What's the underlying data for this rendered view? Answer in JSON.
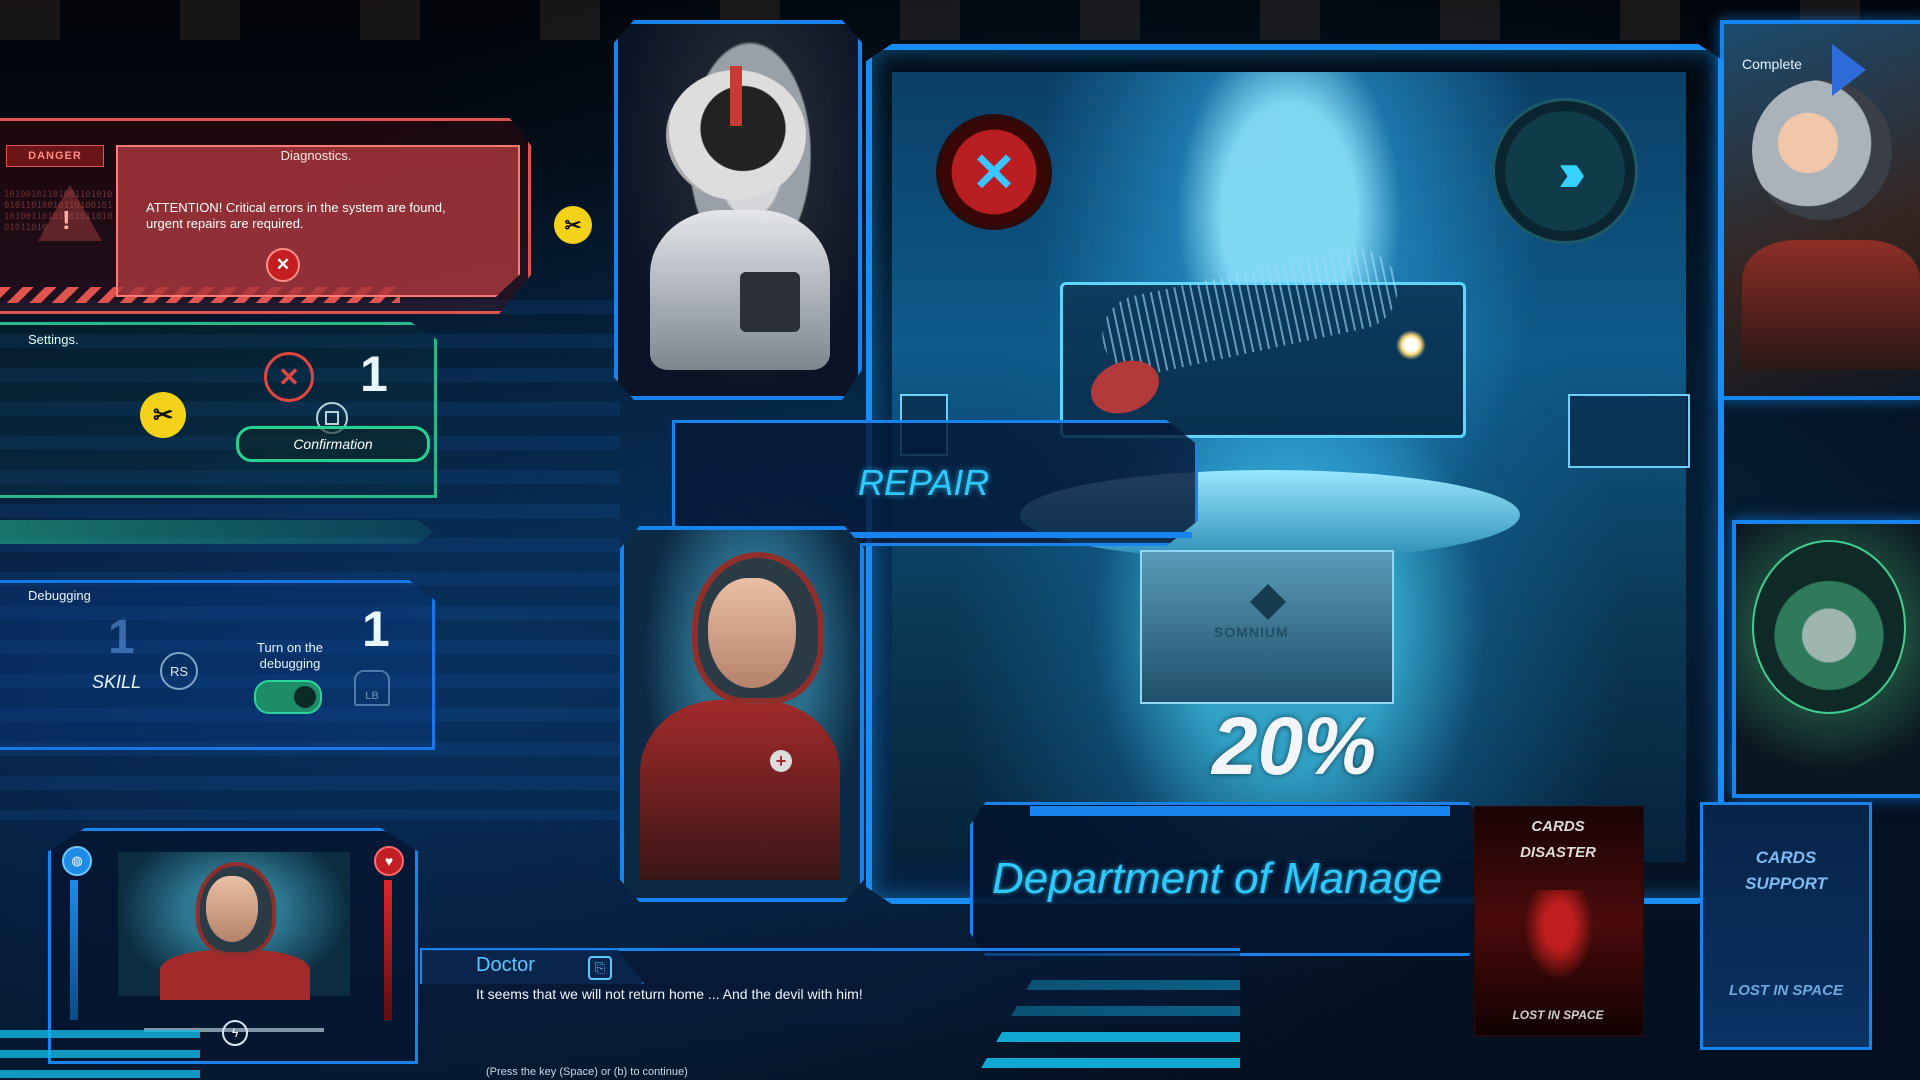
{
  "danger": {
    "tab_label": "DANGER",
    "warning_mark": "!",
    "binary": "10100101101001101010010110100101101001011010011010100101101001011010",
    "diagnostics_title": "Diagnostics.",
    "message": "ATTENTION! Critical errors in the system are found, urgent repairs are required.",
    "close_symbol": "✕"
  },
  "tool_icon": "✂",
  "settings": {
    "title": "Settings.",
    "close_symbol": "✕",
    "number": "1",
    "confirm_label": "Confirmation"
  },
  "debugging": {
    "title": "Debugging",
    "skill_number": "1",
    "skill_label": "SKILL",
    "rs_label": "RS",
    "toggle_label": "Turn on the debugging",
    "number": "1",
    "lb_label": "LB",
    "toggle_on": true
  },
  "complete": {
    "label": "Complete"
  },
  "scene": {
    "repair_symbol": "✕",
    "next_symbol": "›››",
    "progress_percent": 20,
    "progress_label": "20%",
    "logo_text": "SOMNIUM"
  },
  "repair_banner": {
    "label": "REPAIR"
  },
  "department": {
    "label": "Department of Manage"
  },
  "cards": {
    "disaster": {
      "line1": "CARDS",
      "line2": "DISASTER",
      "footer": "LOST IN SPACE"
    },
    "support": {
      "line1": "CARDS",
      "line2": "SUPPORT",
      "footer": "LOST IN SPACE"
    }
  },
  "hud": {
    "left_icon": "◍",
    "right_icon": "♥",
    "bolt_icon": "ϟ"
  },
  "dialogue": {
    "speaker": "Doctor",
    "speaker_icon": "⎘",
    "text": "It seems that we will not return home ... And the devil with him!",
    "hint": "(Press the key (Space) or (b) to continue)"
  },
  "colors": {
    "danger": "#e0534f",
    "settings": "#27b98a",
    "debug": "#1877e6",
    "accent": "#2ec9ff"
  }
}
